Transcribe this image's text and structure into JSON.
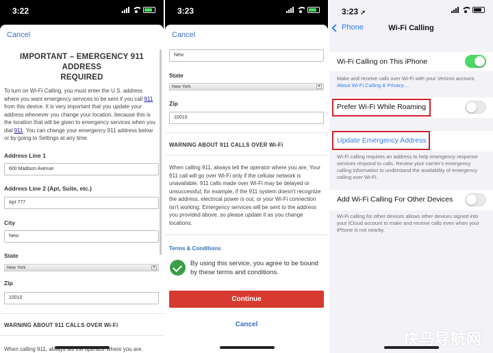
{
  "panel1": {
    "time": "3:22",
    "cancel": "Cancel",
    "title_line1": "IMPORTANT – EMERGENCY 911 ADDRESS",
    "title_line2": "REQUIRED",
    "intro": {
      "part1": "To turn on Wi-Fi Calling, you must enter the U.S. address where you want emergency services to be sent if you call ",
      "link1": "911",
      "part2": " from this device. It is very important that you update your address whenever you change your location, because this is the location that will be given to emergency services when you dial ",
      "link2": "911",
      "part3": ". You can change your emergency 911 address below or by going to Settings at any time."
    },
    "address1_label": "Address Line 1",
    "address1_value": "600 Madison Avenue",
    "address2_label": "Address Line 2 (Apt, Suite, etc.)",
    "address2_value": "Apt 777",
    "city_label": "City",
    "city_value": "New",
    "state_label": "State",
    "state_value": "New York",
    "zip_label": "Zip",
    "zip_value": "10010",
    "warning_heading": "WARNING ABOUT 911 CALLS OVER Wi-Fi",
    "warning_text": "When calling 911, always tell the operator where you are."
  },
  "panel2": {
    "time": "3:23",
    "cancel": "Cancel",
    "city_value": "New",
    "state_label": "State",
    "state_value": "New York",
    "zip_label": "Zip",
    "zip_value": "10010",
    "warning_heading": "WARNING ABOUT 911 CALLS OVER Wi-Fi",
    "warning_text": "When calling 911, always tell the operator where you are. Your 911 call will go over Wi-Fi only if the cellular network is unavailable. 911 calls made over Wi-Fi may be delayed or unsuccessful; for example, if the 911 system doesn't recognize the address, electrical power is out, or your Wi-Fi connection isn't working. Emergency services will be sent to the address you provided above, so please update it as you change locations.",
    "terms_link": "Terms & Conditions",
    "agree_text": "By using this service, you agree to be bound by these terms and conditions.",
    "continue_label": "Continue",
    "cancel_bottom": "Cancel"
  },
  "panel3": {
    "time": "3:23",
    "back_label": "Phone",
    "nav_title": "Wi-Fi Calling",
    "row1_label": "Wi-Fi Calling on This iPhone",
    "row1_on": true,
    "row1_footer": "Make and receive calls over Wi-Fi with your Verizon account.",
    "row1_footer_link": "About Wi-Fi Calling & Privacy…",
    "row2_label": "Prefer Wi-Fi While Roaming",
    "row2_on": false,
    "update_link": "Update Emergency Address",
    "update_footer": "Wi-Fi calling requires an address to help emergency response services respond to calls. Review your carrier's emergency calling information to understand the availability of emergency calling over Wi-Fi.",
    "row3_label": "Add Wi-Fi Calling For Other Devices",
    "row3_on": false,
    "row3_footer": "Wi-Fi calling for other devices allows other devices signed into your iCloud account to make and receive calls even when your iPhone is not nearby."
  },
  "watermark": "快马导航网",
  "colors": {
    "link_blue": "#2f7af6",
    "continue_red": "#d63a2f",
    "highlight_red": "#d21f2b",
    "toggle_green": "#4cd964"
  }
}
